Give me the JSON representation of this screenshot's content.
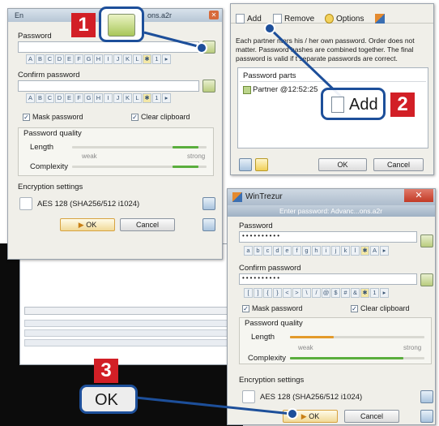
{
  "win_left": {
    "title_prefix": "En",
    "title_suffix": "ons.a2r",
    "password_label": "Password",
    "alphabet_keys": [
      "A",
      "B",
      "C",
      "D",
      "E",
      "F",
      "G",
      "H",
      "I",
      "J",
      "K",
      "L",
      "1"
    ],
    "confirm_label": "Confirm password",
    "mask_label": "Mask password",
    "clear_label": "Clear clipboard",
    "quality_label": "Password quality",
    "length_label": "Length",
    "complexity_label": "Complexity",
    "weak": "weak",
    "strong": "strong",
    "enc_label": "Encryption settings",
    "enc_value": "AES 128  (SHA256/512 i1024)",
    "ok": "OK",
    "cancel": "Cancel"
  },
  "win_right_top": {
    "add": "Add",
    "remove": "Remove",
    "options": "Options",
    "desc_line1": "Each partner  nters his / her own password. Order does not",
    "desc_line2": "matter. Password hashes are combined together. The final",
    "desc_line3": "password is valid if t  separate passwords are correct.",
    "parts_header": "Password parts",
    "part_item": "Partner @12:52:25",
    "ok": "OK",
    "cancel": "Cancel"
  },
  "win_bottom": {
    "app_title": "WinTrezur",
    "subtitle": "Enter password: Advanc...ons.a2r",
    "password_label": "Password",
    "password_value": "••••••••••",
    "lower_keys": [
      "a",
      "b",
      "c",
      "d",
      "e",
      "f",
      "g",
      "h",
      "i",
      "j",
      "k",
      "l",
      "A"
    ],
    "confirm_label": "Confirm password",
    "confirm_value": "••••••••••",
    "symbol_keys": [
      "[",
      "]",
      "{",
      "}",
      "<",
      ">",
      "\\",
      "/",
      "@",
      "$",
      "#",
      "&",
      "1"
    ],
    "mask_label": "Mask password",
    "clear_label": "Clear clipboard",
    "quality_label": "Password quality",
    "length_label": "Length",
    "complexity_label": "Complexity",
    "weak": "weak",
    "strong": "strong",
    "enc_label": "Encryption settings",
    "enc_value": "AES 128  (SHA256/512 i1024)",
    "ok": "OK",
    "cancel": "Cancel"
  },
  "callouts": {
    "one": "1",
    "two": "2",
    "two_label": "Add",
    "three": "3",
    "three_label": "OK"
  },
  "colors": {
    "callout_red": "#d21f26",
    "callout_blue": "#1d4f9a",
    "length_bar": "#e39a2b",
    "complexity_bar": "#5aae3d"
  }
}
